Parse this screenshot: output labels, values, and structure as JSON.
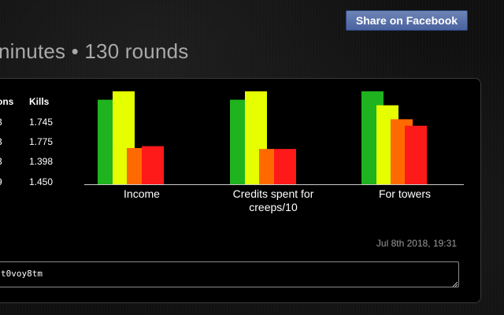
{
  "share": {
    "label": "Share on Facebook",
    "color": "#4a63a0"
  },
  "headline": "ninutes • 130 rounds",
  "stats": {
    "columns": [
      "ons",
      "Kills"
    ],
    "rows": [
      [
        "3",
        "1.745"
      ],
      [
        "3",
        "1.775"
      ],
      [
        "3",
        "1.398"
      ],
      [
        "9",
        "1.450"
      ]
    ]
  },
  "chart_data": {
    "type": "bar",
    "categories": [
      "Income",
      "Credits spent for creeps/10",
      "For towers"
    ],
    "category_lines": [
      [
        "Income"
      ],
      [
        "Credits spent for",
        "creeps/10"
      ],
      [
        "For towers"
      ]
    ],
    "series": [
      {
        "color": "#1fb31f",
        "values": [
          0.91,
          0.91,
          1.0
        ]
      },
      {
        "color": "#e6ff00",
        "values": [
          1.0,
          1.0,
          0.85
        ]
      },
      {
        "color": "#ff6a00",
        "values": [
          0.39,
          0.38,
          0.7
        ]
      },
      {
        "color": "#ff1a1a",
        "values": [
          0.41,
          0.38,
          0.63
        ]
      }
    ],
    "ylim": [
      0,
      1
    ],
    "grid": false,
    "legend": "none"
  },
  "timestamp": "Jul 8th 2018, 19:31",
  "link_field": {
    "value": "t0voy8tm"
  }
}
